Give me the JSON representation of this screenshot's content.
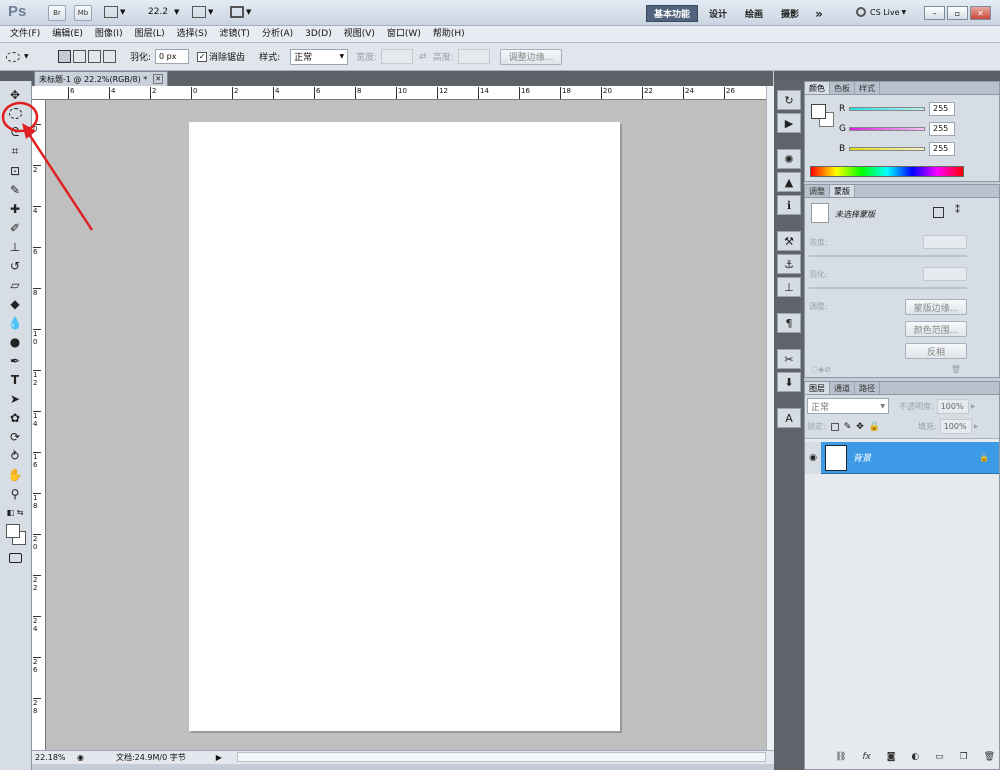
{
  "appbar": {
    "logo": "Ps",
    "br": "Br",
    "mb": "Mb",
    "zoom_value": "22.2",
    "workspaces": [
      "基本功能",
      "设计",
      "绘画",
      "摄影"
    ],
    "more": "»",
    "cslive": "CS Live",
    "window_buttons": [
      "–",
      "▫",
      "✕"
    ]
  },
  "menubar": {
    "items": [
      "文件(F)",
      "编辑(E)",
      "图像(I)",
      "图层(L)",
      "选择(S)",
      "滤镜(T)",
      "分析(A)",
      "3D(D)",
      "视图(V)",
      "窗口(W)",
      "帮助(H)"
    ]
  },
  "options": {
    "feather_label": "羽化:",
    "feather_value": "0 px",
    "antialias_label": "消除锯齿",
    "style_label": "样式:",
    "style_value": "正常",
    "width_label": "宽度:",
    "height_label": "高度:",
    "refine_button": "调整边缘..."
  },
  "document": {
    "tab_title": "未标题-1 @ 22.2%(RGB/8) *",
    "hruler_labels": [
      "6",
      "4",
      "2",
      "0",
      "2",
      "4",
      "6",
      "8",
      "10",
      "12",
      "14",
      "16",
      "18",
      "20",
      "22",
      "24",
      "26"
    ],
    "vruler_labels": [
      "0",
      "2",
      "4",
      "6",
      "8",
      "1 0",
      "1 2",
      "1 4",
      "1 6",
      "1 8",
      "2 0",
      "2 2",
      "2 4",
      "2 6",
      "2 8"
    ]
  },
  "statusbar": {
    "zoom": "22.18%",
    "doc_info": "文档:24.9M/0 字节"
  },
  "color_panel": {
    "tabs": [
      "颜色",
      "色板",
      "样式"
    ],
    "channels": [
      {
        "label": "R",
        "value": "255",
        "color": "#35d6e6"
      },
      {
        "label": "G",
        "value": "255",
        "color": "#e23ee0"
      },
      {
        "label": "B",
        "value": "255",
        "color": "#e6e02c"
      }
    ]
  },
  "masks_panel": {
    "tabs": [
      "调整",
      "蒙版"
    ],
    "no_mask": "未选择蒙版",
    "density_label": "浓度:",
    "feather_label": "羽化:",
    "adjust_label": "调整:",
    "btn_mask_edge": "蒙版边缘...",
    "btn_color_range": "颜色范围...",
    "btn_invert": "反相"
  },
  "layers_panel": {
    "tabs": [
      "图层",
      "通道",
      "路径"
    ],
    "blend_mode": "正常",
    "opacity_label": "不透明度:",
    "opacity_value": "100%",
    "lock_label": "锁定:",
    "fill_label": "填充:",
    "fill_value": "100%",
    "layer_name": "背景"
  },
  "colors": {
    "selected_layer": "#3c9ae6",
    "annotation": "#e02020"
  }
}
